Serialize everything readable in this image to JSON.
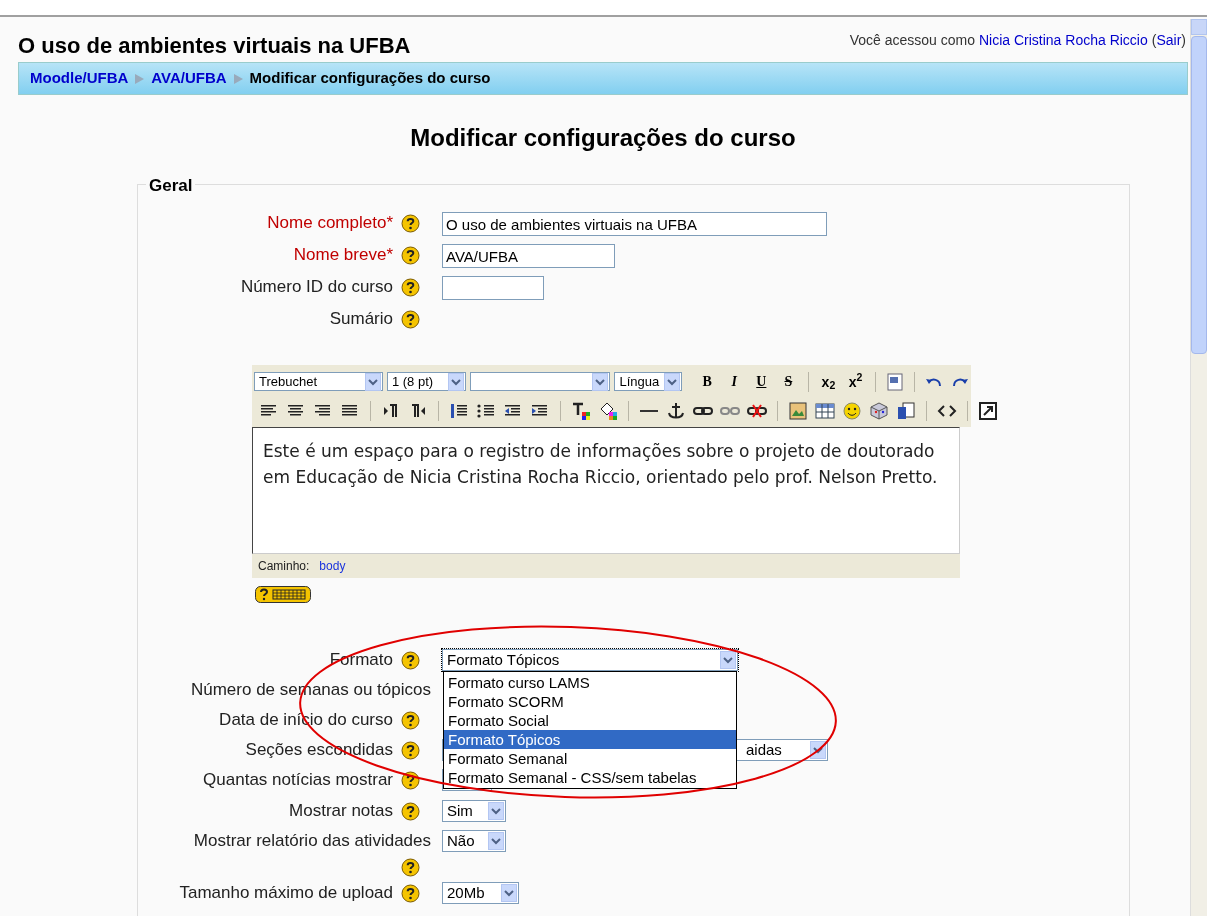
{
  "header": {
    "course_title": "O uso de ambientes virtuais na UFBA",
    "login_text": "Você acessou como",
    "user_link": "Nicia Cristina Rocha Riccio",
    "paren_open": "(",
    "logout_link": "Sair",
    "paren_close": ")"
  },
  "breadcrumb": [
    {
      "label": "Moodle/UFBA",
      "link": true
    },
    {
      "label": "AVA/UFBA",
      "link": true
    },
    {
      "label": "Modificar configurações do curso",
      "link": false
    }
  ],
  "heading": "Modificar configurações do curso",
  "fieldset": {
    "legend": "Geral",
    "fields": [
      {
        "kind": "text",
        "label": "Nome completo*",
        "required": true,
        "help": true,
        "value": "O uso de ambientes virtuais na UFBA"
      },
      {
        "kind": "text",
        "label": "Nome breve*",
        "required": true,
        "help": true,
        "value": "AVA/UFBA"
      },
      {
        "kind": "text",
        "label": "Número ID do curso",
        "required": false,
        "help": true
      },
      {
        "kind": "editor",
        "label": "Sumário",
        "required": false,
        "help": true,
        "editor": {
          "font": "Trebuchet",
          "size": "1 (8 pt)",
          "language": "Língua",
          "format_buttons": [
            "B",
            "I",
            "U",
            "S",
            "x$_{2}$",
            "x$^{2}$"
          ],
          "content": "Este é um espaço para o registro de informações sobre o projeto de doutorado em Educação de Nicia Cristina Rocha Riccio, orientado pelo prof. Nelson Pretto.",
          "path_label": "Caminho:",
          "path": "body"
        }
      },
      {
        "kind": "select",
        "label": "Formato",
        "required": false,
        "help": true,
        "value": "Formato Tópicos",
        "expanded": true,
        "options": [
          {
            "label": "Formato curso LAMS",
            "selected": false
          },
          {
            "label": "Formato SCORM",
            "selected": false
          },
          {
            "label": "Formato Social",
            "selected": false
          },
          {
            "label": "Formato Tópicos",
            "selected": true
          },
          {
            "label": "Formato Semanal",
            "selected": false
          },
          {
            "label": "Formato Semanal - CSS/sem tabelas",
            "selected": false
          }
        ]
      },
      {
        "kind": "covered",
        "label": "Número de semanas ou tópicos",
        "required": false,
        "help": false
      },
      {
        "kind": "covered",
        "label": "Data de início do curso",
        "required": false,
        "help": true
      },
      {
        "kind": "select",
        "label": "Seções escondidas",
        "required": false,
        "help": true,
        "value": "aidas"
      },
      {
        "kind": "covered_select",
        "label": "Quantas notícias mostrar",
        "required": false,
        "help": true
      },
      {
        "kind": "select",
        "label": "Mostrar notas",
        "required": false,
        "help": true,
        "value": "Sim"
      },
      {
        "kind": "select",
        "label": "Mostrar relatório das atividades",
        "required": false,
        "help": true,
        "value": "Não"
      },
      {
        "kind": "select",
        "label": "Tamanho máximo de upload",
        "required": false,
        "help": true,
        "value": "20Mb"
      }
    ]
  }
}
